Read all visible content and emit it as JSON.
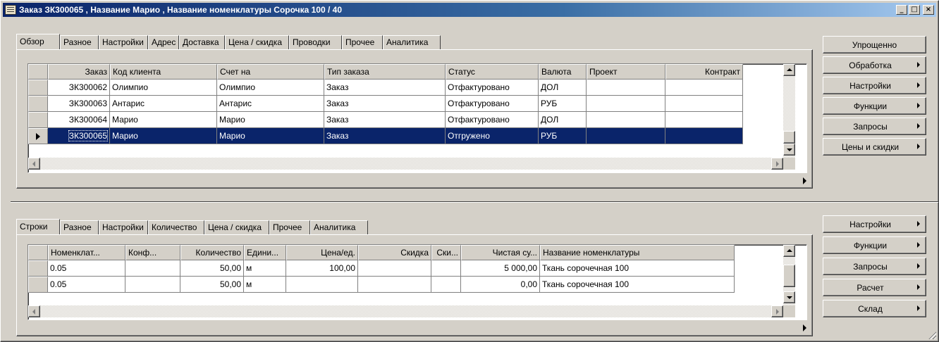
{
  "window": {
    "title": "Заказ ЗК300065 , Название  Марио , Название номенклатуры Сорочка 100 / 40",
    "min_label": "_",
    "max_label": "□",
    "close_label": "×"
  },
  "orders": {
    "tabs": [
      "Обзор",
      "Разное",
      "Настройки",
      "Адрес",
      "Доставка",
      "Цена / скидка",
      "Проводки",
      "Прочее",
      "Аналитика"
    ],
    "active_tab": "Обзор",
    "columns": [
      "Заказ",
      "Код клиента",
      "Счет на",
      "Тип заказа",
      "Статус",
      "Валюта",
      "Проект",
      "Контракт"
    ],
    "rows": [
      [
        "ЗК300062",
        "Олимпио",
        "Олимпио",
        "Заказ",
        "Отфактуровано",
        "ДОЛ",
        "",
        ""
      ],
      [
        "ЗК300063",
        "Антарис",
        "Антарис",
        "Заказ",
        "Отфактуровано",
        "РУБ",
        "",
        ""
      ],
      [
        "ЗК300064",
        "Марио",
        "Марио",
        "Заказ",
        "Отфактуровано",
        "ДОЛ",
        "",
        ""
      ],
      [
        "ЗК300065",
        "Марио",
        "Марио",
        "Заказ",
        "Отгружено",
        "РУБ",
        "",
        ""
      ]
    ],
    "selected_row": 3
  },
  "lines": {
    "tabs": [
      "Строки",
      "Разное",
      "Настройки",
      "Количество",
      "Цена / скидка",
      "Прочее",
      "Аналитика"
    ],
    "active_tab": "Строки",
    "columns": [
      "Номенклат...",
      "Конф...",
      "Количество",
      "Едини...",
      "Цена/ед.",
      "Скидка",
      "Ски...",
      "Чистая су...",
      "Название номенклатуры"
    ],
    "rows": [
      [
        "0.05",
        "",
        "50,00",
        "м",
        "100,00",
        "",
        "",
        "5 000,00",
        "Ткань сорочечная 100"
      ],
      [
        "0.05",
        "",
        "50,00",
        "м",
        "",
        "",
        "",
        "0,00",
        "Ткань сорочечная 100"
      ]
    ]
  },
  "top_buttons": [
    {
      "label": "Упрощенно",
      "menu": false
    },
    {
      "label": "Обработка",
      "menu": true
    },
    {
      "label": "Настройки",
      "menu": true
    },
    {
      "label": "Функции",
      "menu": true
    },
    {
      "label": "Запросы",
      "menu": true
    },
    {
      "label": "Цены и скидки",
      "menu": true
    }
  ],
  "bottom_buttons": [
    {
      "label": "Настройки",
      "menu": true
    },
    {
      "label": "Функции",
      "menu": true
    },
    {
      "label": "Запросы",
      "menu": true
    },
    {
      "label": "Расчет",
      "menu": true
    },
    {
      "label": "Склад",
      "menu": true
    }
  ]
}
